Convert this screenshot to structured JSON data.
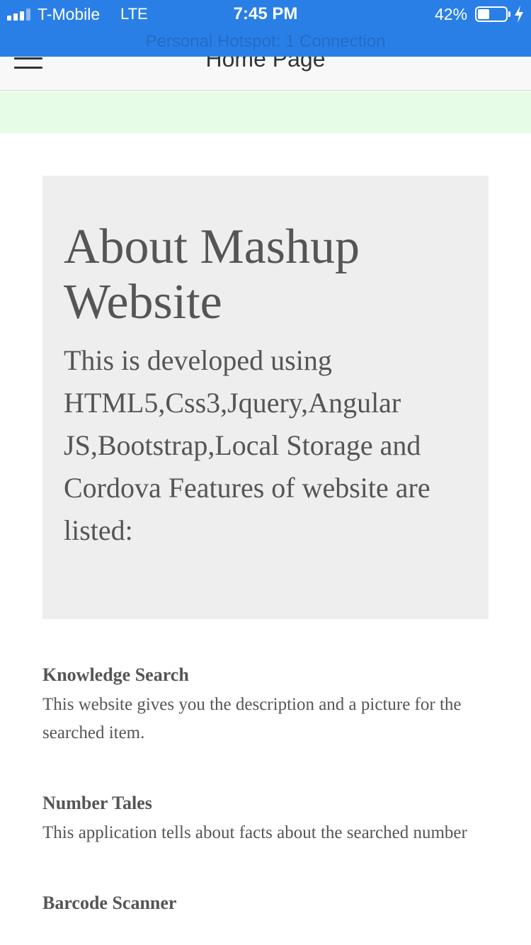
{
  "status_bar": {
    "carrier": "T-Mobile",
    "network": "LTE",
    "time": "7:45 PM",
    "battery_percent": "42%",
    "battery_level": 0.42,
    "hotspot": "Personal Hotspot: 1 Connection",
    "background_color": "#2a7fe6"
  },
  "navbar": {
    "menu_icon": "hamburger-menu-icon",
    "title": "Home Page"
  },
  "jumbotron": {
    "heading": "About Mashup Website",
    "description": "This is developed using HTML5,Css3,Jquery,Angular JS,Bootstrap,Local Storage and Cordova Features of website are listed:"
  },
  "features": [
    {
      "title": "Knowledge Search",
      "description": "This website gives you the description and a picture for the searched item."
    },
    {
      "title": "Number Tales",
      "description": "This application tells about facts about the searched number"
    },
    {
      "title": "Barcode Scanner",
      "description": ""
    }
  ],
  "colors": {
    "notice_band": "#e6fce6",
    "jumbotron_background": "#eeeeee",
    "text": "#555555"
  }
}
